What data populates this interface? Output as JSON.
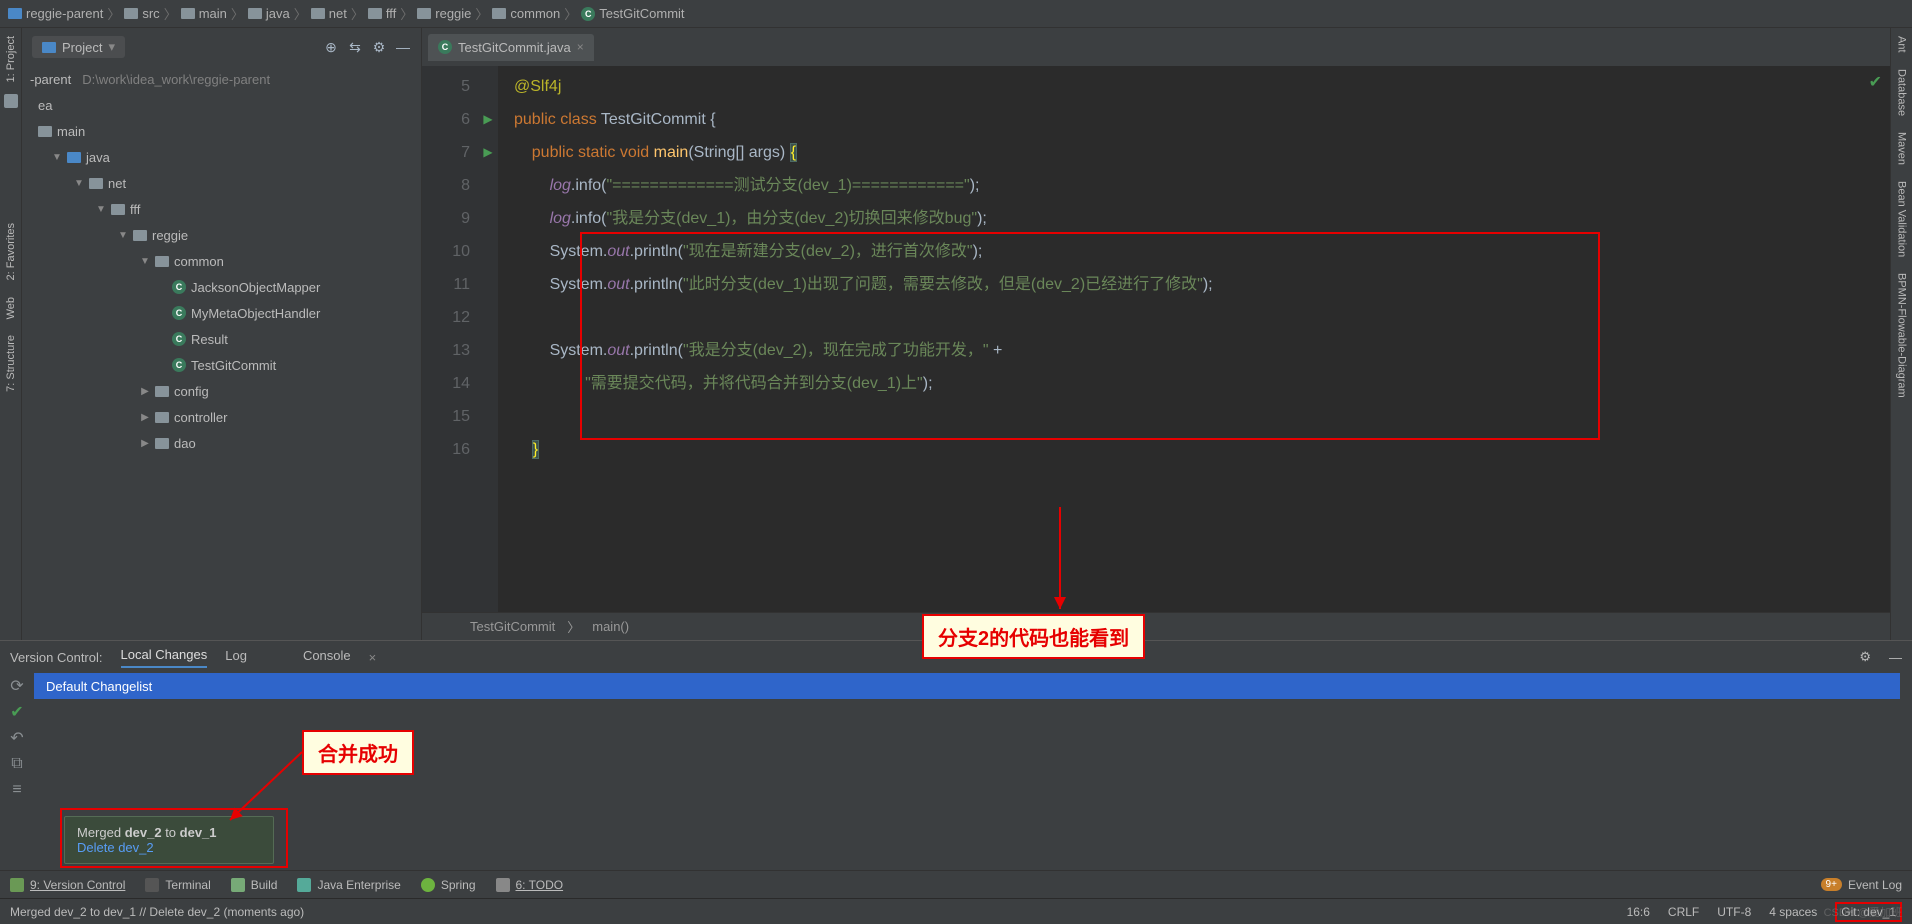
{
  "breadcrumb": [
    "reggie-parent",
    "src",
    "main",
    "java",
    "net",
    "fff",
    "reggie",
    "common",
    "TestGitCommit"
  ],
  "project": {
    "title": "Project",
    "root": "-parent",
    "rootPath": "D:\\work\\idea_work\\reggie-parent",
    "nodes": {
      "idea": "ea",
      "main": "main",
      "java": "java",
      "net": "net",
      "fff": "fff",
      "reggie": "reggie",
      "common": "common",
      "files": [
        "JacksonObjectMapper",
        "MyMetaObjectHandler",
        "Result",
        "TestGitCommit"
      ],
      "pkgs": [
        "config",
        "controller",
        "dao"
      ]
    }
  },
  "tab": {
    "name": "TestGitCommit.java"
  },
  "gutter": [
    "5",
    "6",
    "7",
    "8",
    "9",
    "10",
    "11",
    "12",
    "13",
    "14",
    "15",
    "16"
  ],
  "code": {
    "l5": "@Slf4j",
    "l6_kw1": "public class",
    "l6_cls": "TestGitCommit",
    "l6_br": "{",
    "l7_kw1": "public static void",
    "l7_mth": "main",
    "l7_args": "(String[] args)",
    "l7_br": "{",
    "l8_fld": "log",
    "l8_mth": ".info(",
    "l8_str": "\"=============测试分支(dev_1)============\"",
    "l8_end": ");",
    "l9_fld": "log",
    "l9_mth": ".info(",
    "l9_str": "\"我是分支(dev_1)，由分支(dev_2)切换回来修改bug\"",
    "l9_end": ");",
    "l10_sys": "System.",
    "l10_out": "out",
    "l10_prn": ".println(",
    "l10_str": "\"现在是新建分支(dev_2)，进行首次修改\"",
    "l10_end": ");",
    "l11_sys": "System.",
    "l11_out": "out",
    "l11_prn": ".println(",
    "l11_str": "\"此时分支(dev_1)出现了问题，需要去修改，但是(dev_2)已经进行了修改\"",
    "l11_end": ");",
    "l13_sys": "System.",
    "l13_out": "out",
    "l13_prn": ".println(",
    "l13_str": "\"我是分支(dev_2)，现在完成了功能开发，\"",
    "l13_plus": " +",
    "l14_str": "\"需要提交代码，并将代码合并到分支(dev_1)上\"",
    "l14_end": ");",
    "l16_br": "}"
  },
  "editor_crumb": {
    "a": "TestGitCommit",
    "b": "main()"
  },
  "vc": {
    "title": "Version Control:",
    "tabs": {
      "local": "Local Changes",
      "log": "Log",
      "console": "Console"
    },
    "changelist": "Default Changelist"
  },
  "notify": {
    "line1_a": "Merged ",
    "line1_b": "dev_2",
    "line1_c": " to ",
    "line1_d": "dev_1",
    "link": "Delete dev_2"
  },
  "anno": {
    "mergeOk": "合并成功",
    "seeBranch2": "分支2的代码也能看到"
  },
  "toolButtons": {
    "vc": "9: Version Control",
    "terminal": "Terminal",
    "build": "Build",
    "javaEe": "Java Enterprise",
    "spring": "Spring",
    "todo": "6: TODO",
    "eventLog": "Event Log",
    "badge": "9+"
  },
  "status": {
    "msg": "Merged dev_2 to dev_1 // Delete dev_2 (moments ago)",
    "pos": "16:6",
    "eol": "CRLF",
    "enc": "UTF-8",
    "indent": "4 spaces",
    "git": "Git: dev_1"
  },
  "leftTools": [
    "1: Project",
    "2: Favorites",
    "7: Structure",
    "Web"
  ],
  "rightTools": [
    "Ant",
    "Database",
    "Maven",
    "Bean Validation",
    "BPMN-Flowable-Diagram"
  ],
  "watermark": "CSDN @爱加班"
}
